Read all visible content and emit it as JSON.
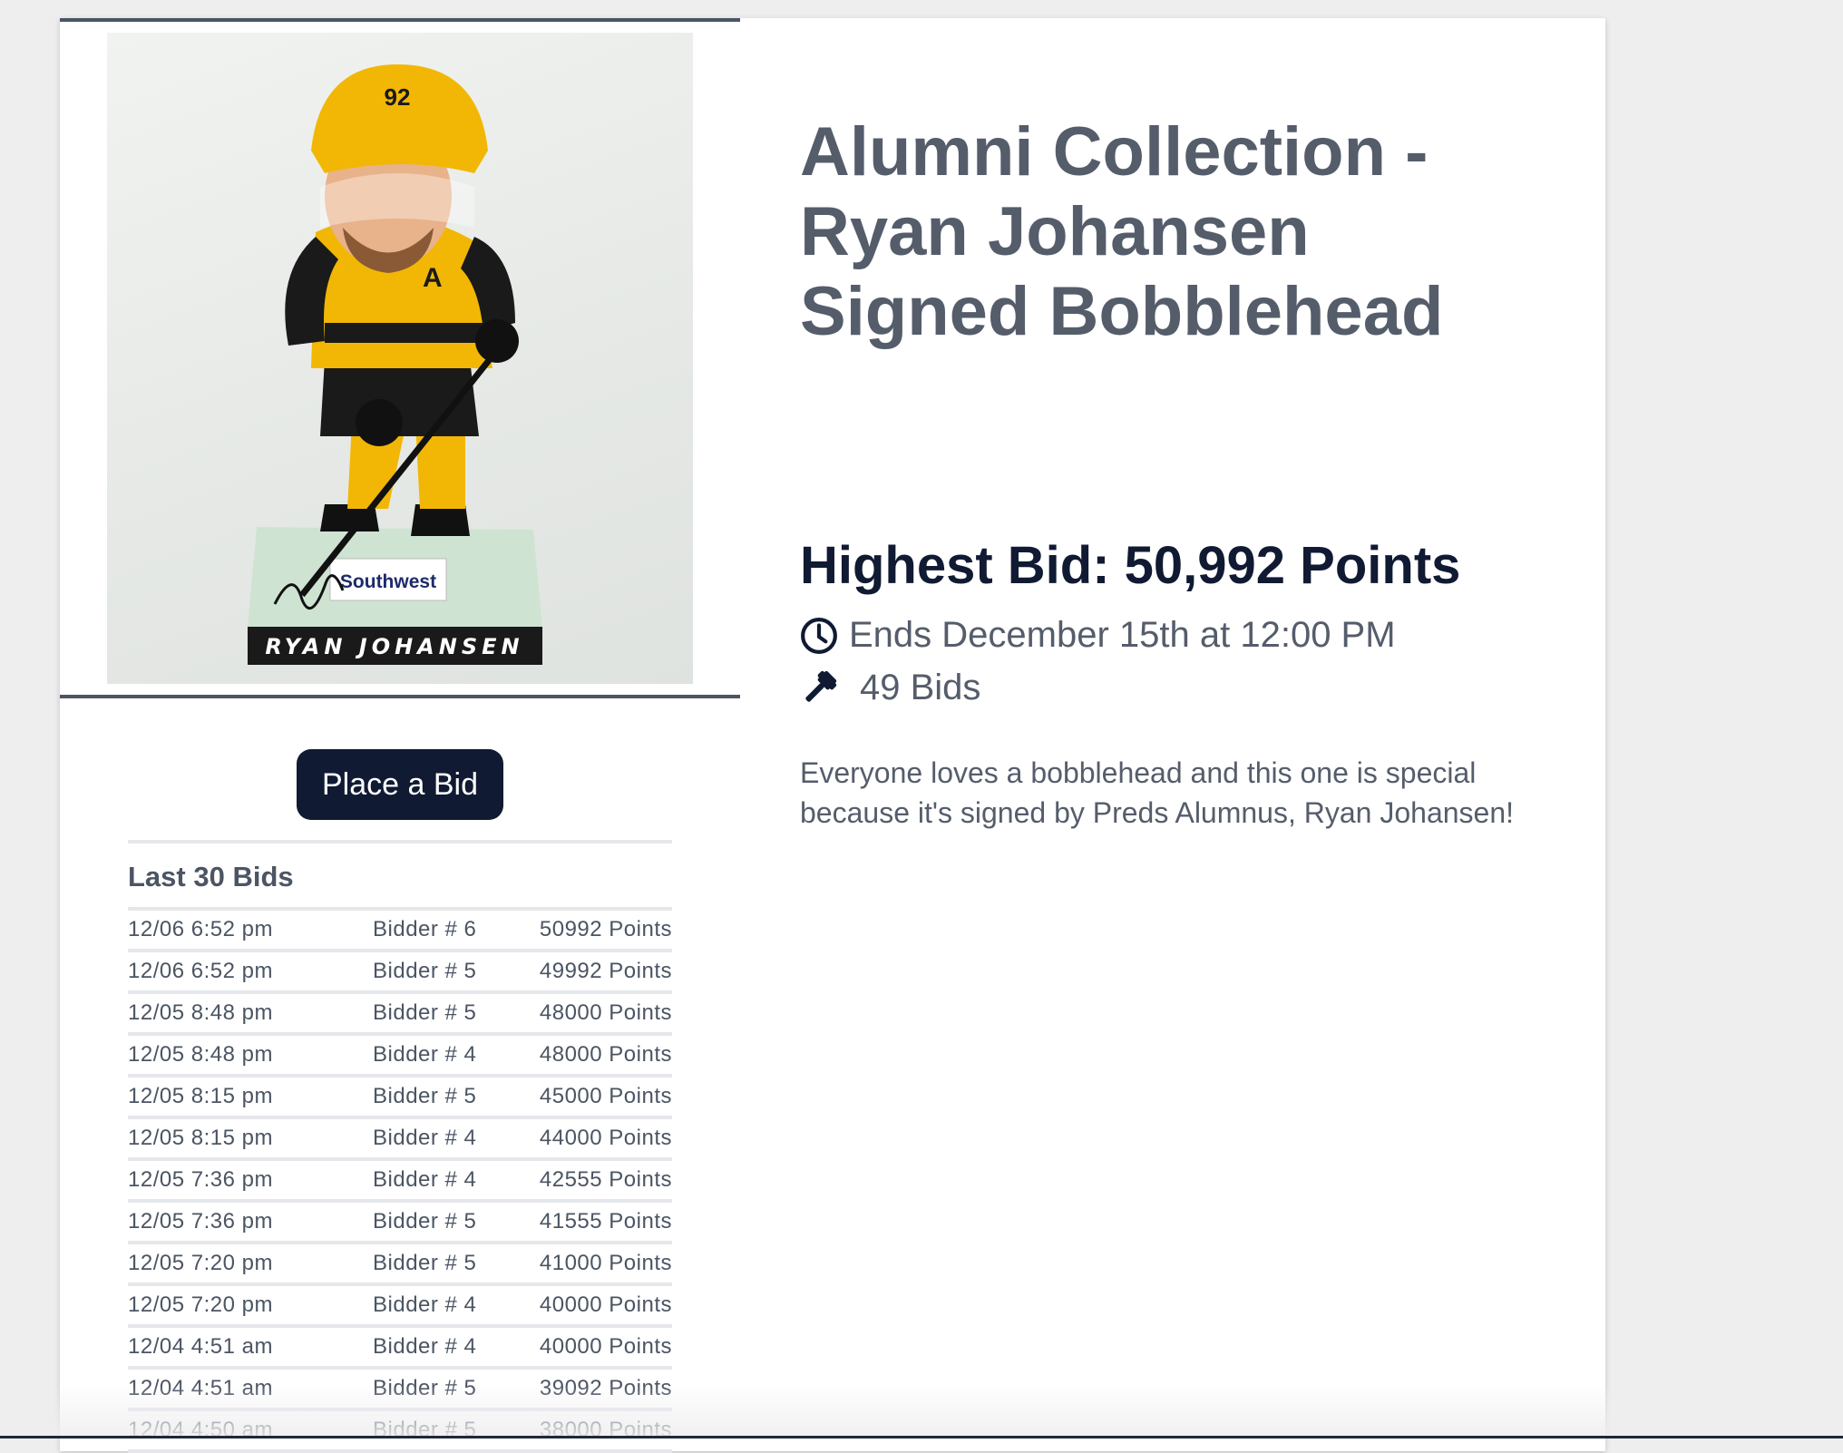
{
  "item": {
    "title": "Alumni Collection - Ryan Johansen Signed Bobblehead",
    "image": {
      "jersey_number": "92",
      "base_name": "RYAN JOHANSEN",
      "sponsor": "Southwest"
    }
  },
  "bidding": {
    "highest_bid": "Highest Bid: 50,992 Points",
    "ends": "Ends December 15th at 12:00 PM",
    "bid_count": "49 Bids",
    "place_bid_label": "Place a Bid"
  },
  "description": "Everyone loves a bobblehead and this one is special because it's signed by Preds Alumnus, Ryan Johansen!",
  "icons": {
    "ends": "clock-icon",
    "bids": "gavel-icon"
  },
  "colors": {
    "accent_navy": "#111a33",
    "text_gray": "#555d6b"
  },
  "last_bids": {
    "title": "Last 30 Bids",
    "rows": [
      {
        "time": "12/06 6:52 pm",
        "bidder": "Bidder # 6",
        "amount": "50992 Points"
      },
      {
        "time": "12/06 6:52 pm",
        "bidder": "Bidder # 5",
        "amount": "49992 Points"
      },
      {
        "time": "12/05 8:48 pm",
        "bidder": "Bidder # 5",
        "amount": "48000 Points"
      },
      {
        "time": "12/05 8:48 pm",
        "bidder": "Bidder # 4",
        "amount": "48000 Points"
      },
      {
        "time": "12/05 8:15 pm",
        "bidder": "Bidder # 5",
        "amount": "45000 Points"
      },
      {
        "time": "12/05 8:15 pm",
        "bidder": "Bidder # 4",
        "amount": "44000 Points"
      },
      {
        "time": "12/05 7:36 pm",
        "bidder": "Bidder # 4",
        "amount": "42555 Points"
      },
      {
        "time": "12/05 7:36 pm",
        "bidder": "Bidder # 5",
        "amount": "41555 Points"
      },
      {
        "time": "12/05 7:20 pm",
        "bidder": "Bidder # 5",
        "amount": "41000 Points"
      },
      {
        "time": "12/05 7:20 pm",
        "bidder": "Bidder # 4",
        "amount": "40000 Points"
      },
      {
        "time": "12/04 4:51 am",
        "bidder": "Bidder # 4",
        "amount": "40000 Points"
      },
      {
        "time": "12/04 4:51 am",
        "bidder": "Bidder # 5",
        "amount": "39092 Points"
      },
      {
        "time": "12/04 4:50 am",
        "bidder": "Bidder # 5",
        "amount": "38000 Points"
      }
    ]
  }
}
